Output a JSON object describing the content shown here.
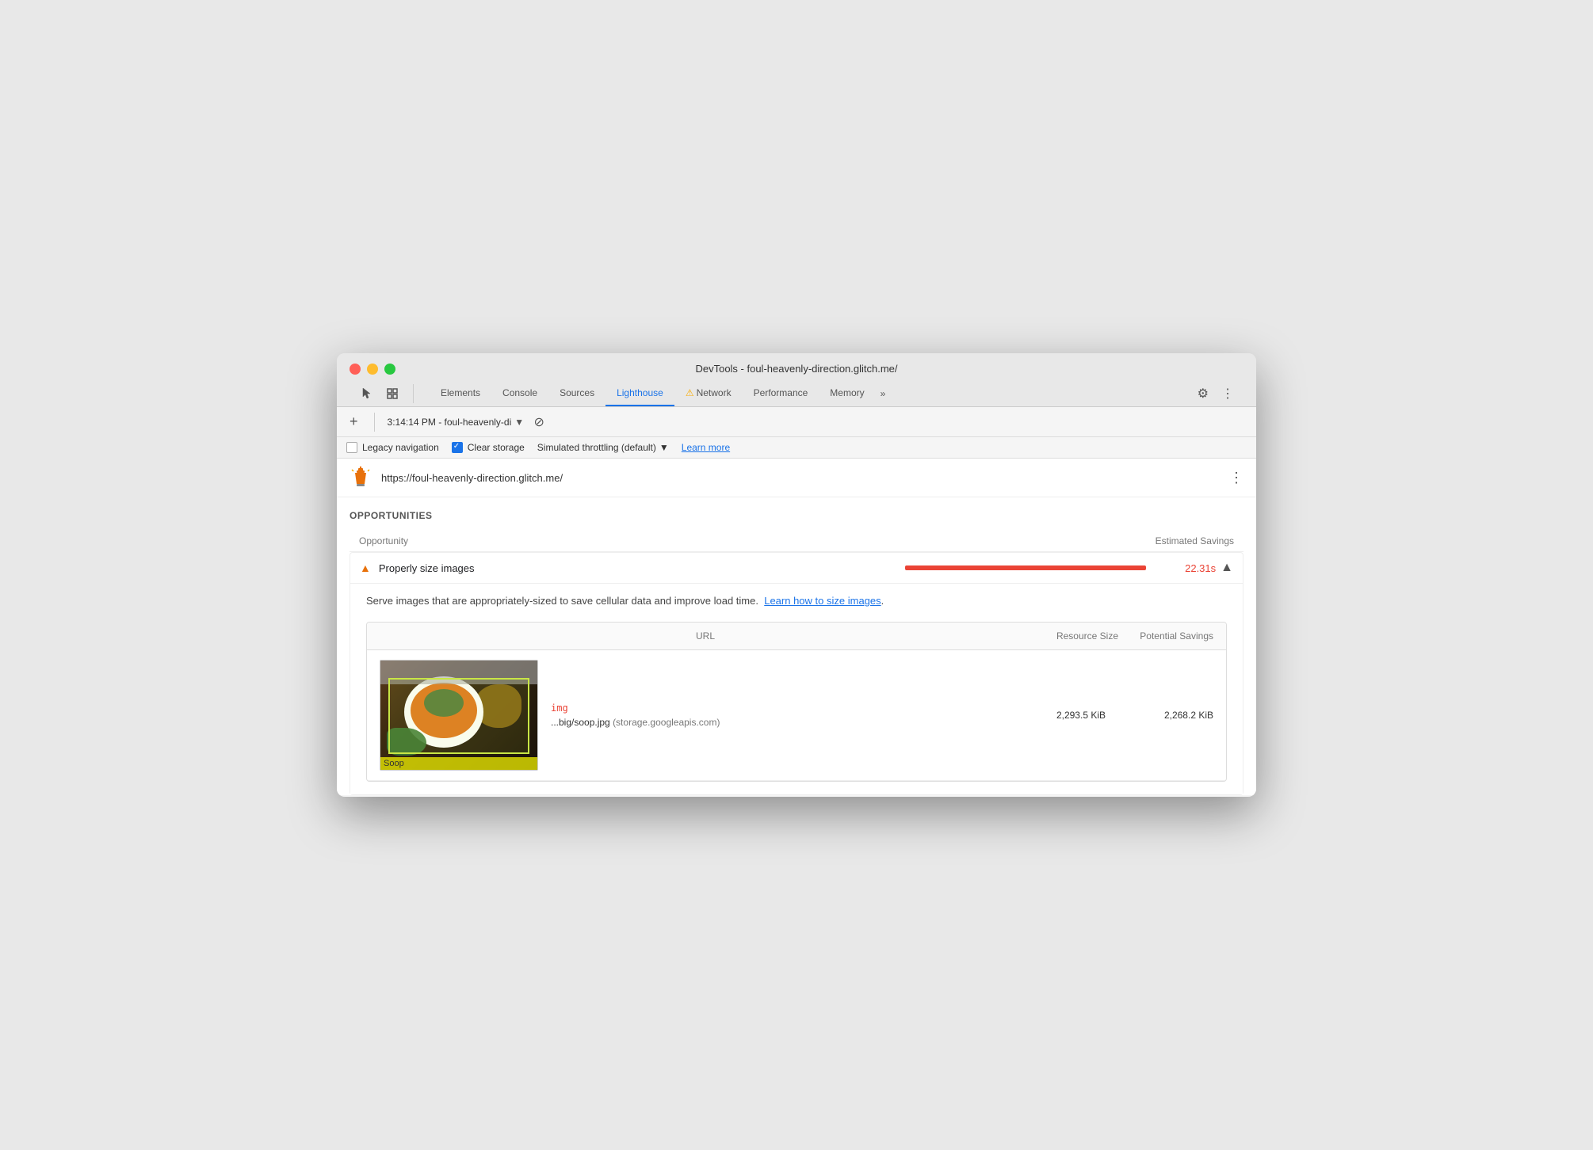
{
  "window": {
    "title": "DevTools - foul-heavenly-direction.glitch.me/"
  },
  "tabs": [
    {
      "id": "elements",
      "label": "Elements",
      "active": false,
      "warning": false
    },
    {
      "id": "console",
      "label": "Console",
      "active": false,
      "warning": false
    },
    {
      "id": "sources",
      "label": "Sources",
      "active": false,
      "warning": false
    },
    {
      "id": "lighthouse",
      "label": "Lighthouse",
      "active": true,
      "warning": false
    },
    {
      "id": "network",
      "label": "Network",
      "active": false,
      "warning": true
    },
    {
      "id": "performance",
      "label": "Performance",
      "active": false,
      "warning": false
    },
    {
      "id": "memory",
      "label": "Memory",
      "active": false,
      "warning": false
    }
  ],
  "toolbar": {
    "more_tabs_label": "»",
    "session_label": "3:14:14 PM - foul-heavenly-di",
    "session_chevron": "▼",
    "no_entry_icon": "⊘"
  },
  "options": {
    "legacy_nav_label": "Legacy navigation",
    "legacy_nav_checked": false,
    "clear_storage_label": "Clear storage",
    "clear_storage_checked": true,
    "throttling_label": "Simulated throttling (default)",
    "throttling_chevron": "▼",
    "learn_more_label": "Learn more"
  },
  "url_row": {
    "url": "https://foul-heavenly-direction.glitch.me/",
    "more_icon": "⋮"
  },
  "opportunities": {
    "section_title": "OPPORTUNITIES",
    "table_header": {
      "opportunity_col": "Opportunity",
      "savings_col": "Estimated Savings"
    },
    "items": [
      {
        "id": "properly-size-images",
        "title": "Properly size images",
        "savings": "22.31s",
        "bar_width_pct": 95,
        "expanded": true,
        "description": "Serve images that are appropriately-sized to save cellular data and improve load time.",
        "learn_link_label": "Learn how to size images",
        "table": {
          "url_col": "URL",
          "resource_size_col": "Resource Size",
          "potential_savings_col": "Potential Savings",
          "rows": [
            {
              "tag": "img",
              "filename": "...big/soop.jpg",
              "domain": "(storage.googleapis.com)",
              "resource_size": "2,293.5 KiB",
              "potential_savings": "2,268.2 KiB",
              "thumb_label": "Soop"
            }
          ]
        }
      }
    ]
  }
}
